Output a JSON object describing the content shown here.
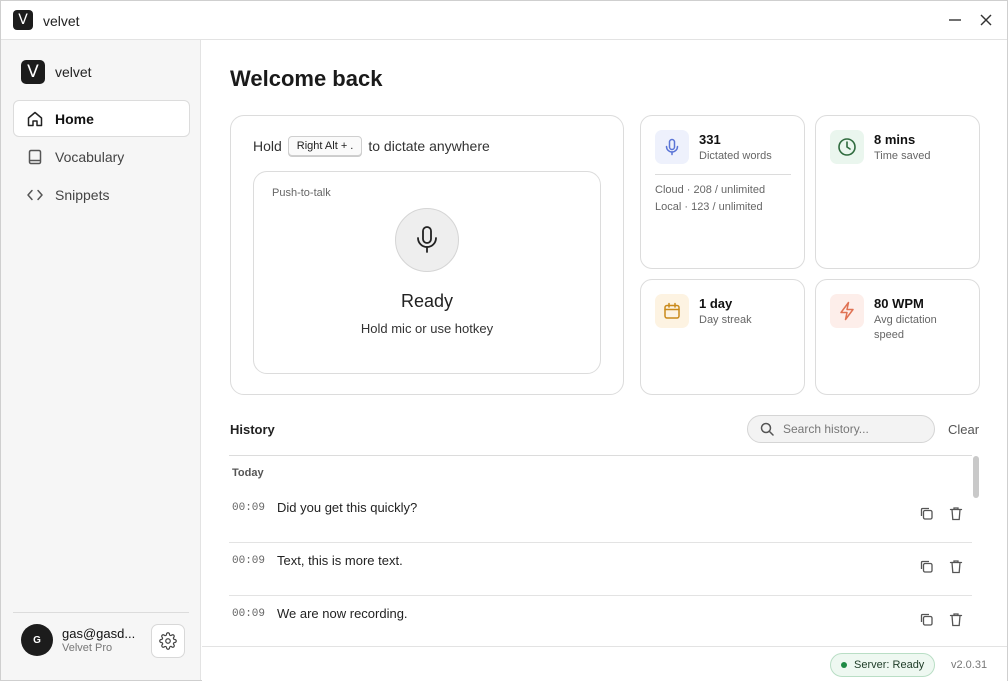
{
  "window": {
    "title": "velvet",
    "logo_letter": "V"
  },
  "sidebar": {
    "brand": "velvet",
    "logo_letter": "V",
    "items": [
      {
        "label": "Home",
        "icon": "home-icon",
        "active": true
      },
      {
        "label": "Vocabulary",
        "icon": "book-icon",
        "active": false
      },
      {
        "label": "Snippets",
        "icon": "code-icon",
        "active": false
      }
    ],
    "user": {
      "initial": "G",
      "email": "gas@gasd...",
      "plan": "Velvet Pro"
    }
  },
  "main": {
    "title": "Welcome back",
    "dictate": {
      "hold_prefix": "Hold",
      "hotkey": "Right Alt + .",
      "hold_suffix": "to dictate anywhere",
      "ptt_label": "Push-to-talk",
      "status": "Ready",
      "hint": "Hold mic or use hotkey"
    },
    "stats": [
      {
        "value": "331",
        "label": "Dictated words",
        "icon": "mic-icon",
        "color": "#5a74d6",
        "bg": "#eef1fc",
        "details": [
          "Cloud · 208 / unlimited",
          "Local · 123 / unlimited"
        ]
      },
      {
        "value": "8 mins",
        "label": "Time saved",
        "icon": "clock-icon",
        "color": "#2f7d46",
        "bg": "#eaf6ee"
      },
      {
        "value": "1 day",
        "label": "Day streak",
        "icon": "calendar-icon",
        "color": "#c98a1b",
        "bg": "#fdf3e2"
      },
      {
        "value": "80 WPM",
        "label": "Avg dictation speed",
        "icon": "bolt-icon",
        "color": "#e07254",
        "bg": "#fdeeea"
      }
    ]
  },
  "history": {
    "title": "History",
    "search_placeholder": "Search history...",
    "clear_label": "Clear",
    "groups": [
      {
        "label": "Today",
        "items": [
          {
            "time": "00:09",
            "text": "Did you get this quickly?"
          },
          {
            "time": "00:09",
            "text": "Text, this is more text."
          },
          {
            "time": "00:09",
            "text": "We are now recording."
          }
        ]
      }
    ]
  },
  "footer": {
    "status": "Server: Ready",
    "status_color": "#1e8a44",
    "version": "v2.0.31"
  }
}
